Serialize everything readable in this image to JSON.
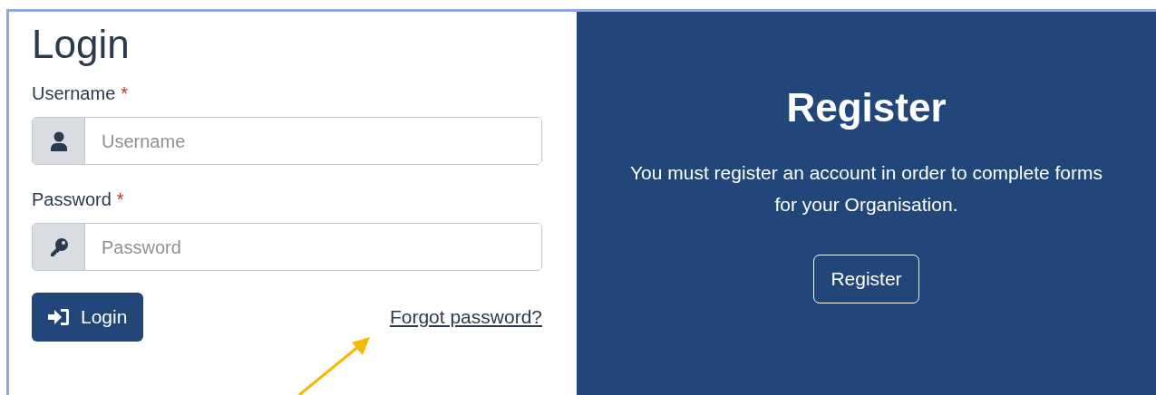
{
  "login": {
    "title": "Login",
    "fields": [
      {
        "label": "Username",
        "required": true,
        "placeholder": "Username",
        "kind": "user"
      },
      {
        "label": "Password",
        "required": true,
        "placeholder": "Password",
        "kind": "key"
      }
    ],
    "required_mark": "*",
    "button": "Login",
    "forgot_link": "Forgot password?"
  },
  "register": {
    "title": "Register",
    "text": "You must register an account in order to complete forms for your Organisation.",
    "button": "Register"
  }
}
